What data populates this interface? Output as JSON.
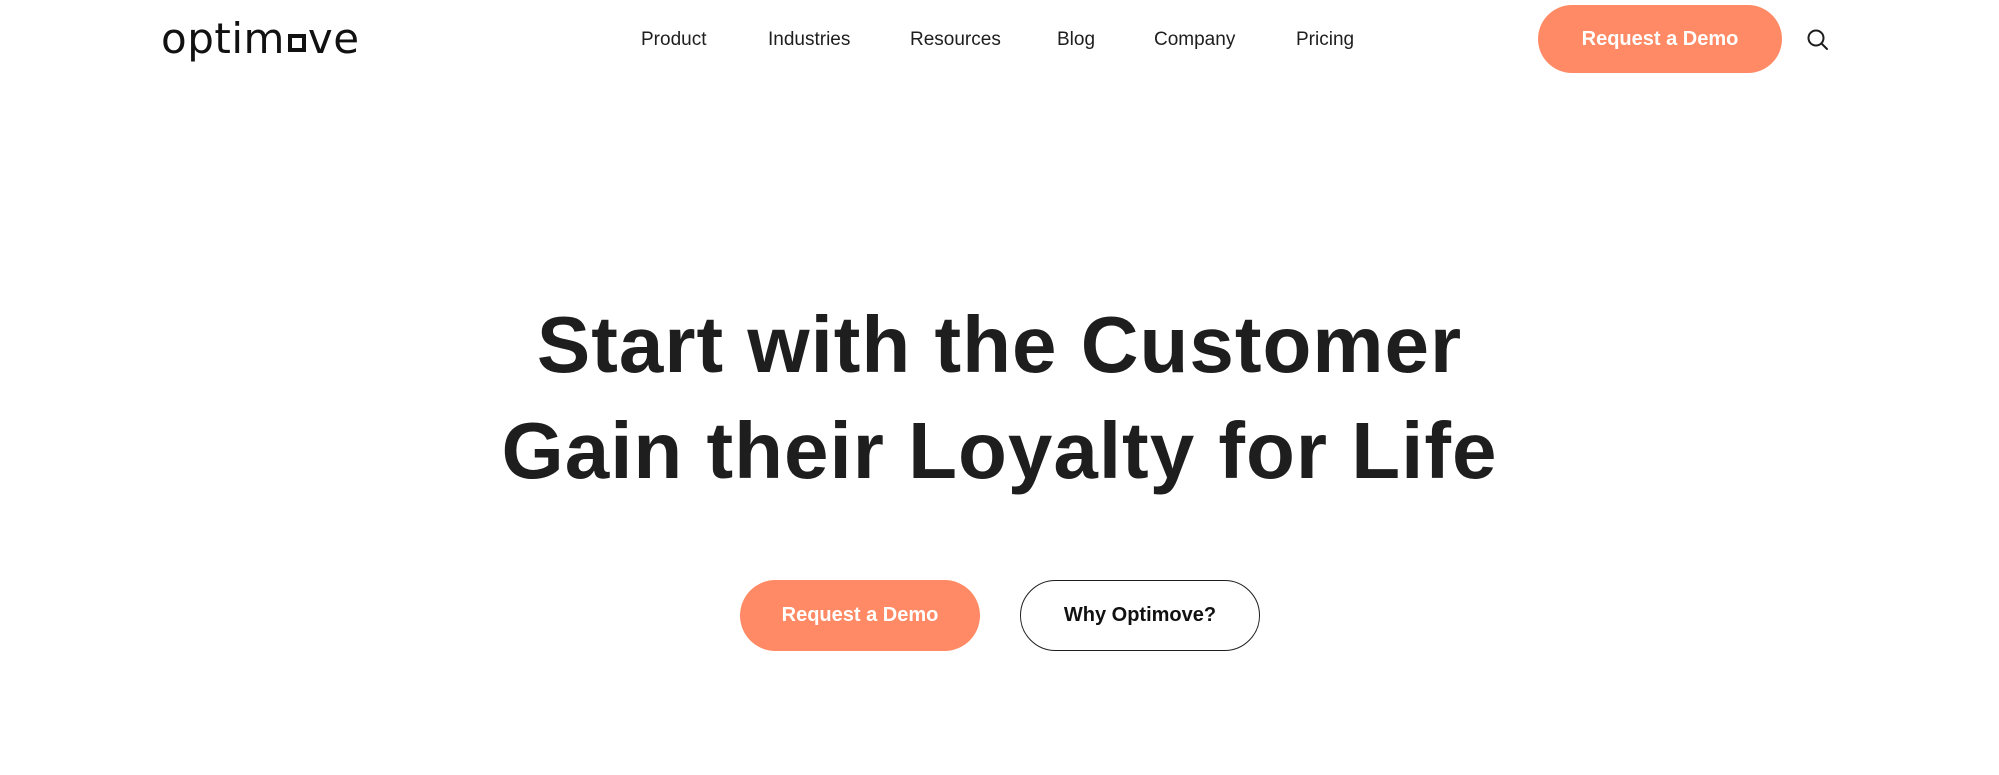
{
  "header": {
    "logo": {
      "text_before": "optim",
      "text_after": "ve"
    },
    "nav": [
      {
        "label": "Product"
      },
      {
        "label": "Industries"
      },
      {
        "label": "Resources"
      },
      {
        "label": "Blog"
      },
      {
        "label": "Company"
      },
      {
        "label": "Pricing"
      }
    ],
    "cta_label": "Request a Demo",
    "search_icon": "search-icon"
  },
  "hero": {
    "title_line1": "Start with the Customer",
    "title_line2": "Gain their Loyalty for Life",
    "primary_label": "Request a Demo",
    "secondary_label": "Why Optimove?"
  },
  "colors": {
    "accent": "#ff8a65",
    "text": "#1e1e1e",
    "background": "#ffffff"
  }
}
